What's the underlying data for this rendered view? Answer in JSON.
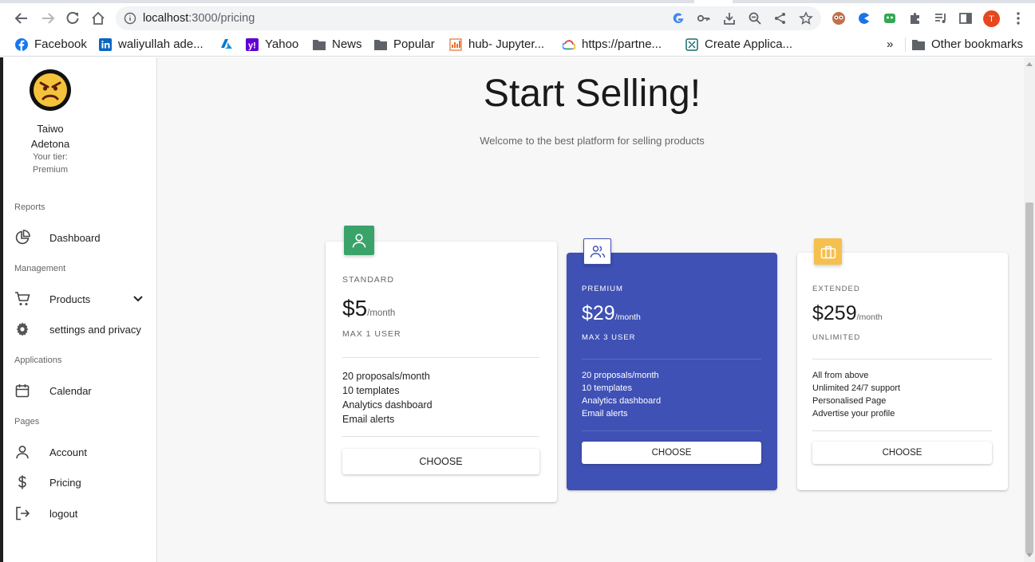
{
  "browser": {
    "url_host": "localhost",
    "url_path": ":3000/pricing",
    "profile_initial": "T",
    "bookmarks": [
      {
        "label": "Facebook",
        "icon": "facebook-icon"
      },
      {
        "label": "waliyullah ade...",
        "icon": "linkedin-icon"
      },
      {
        "label": "",
        "icon": "azure-icon"
      },
      {
        "label": "Yahoo",
        "icon": "yahoo-icon"
      },
      {
        "label": "News",
        "icon": "folder-icon"
      },
      {
        "label": "Popular",
        "icon": "folder-icon"
      },
      {
        "label": "hub- Jupyter...",
        "icon": "jupyter-icon"
      },
      {
        "label": "https://partne...",
        "icon": "google-cloud-icon"
      },
      {
        "label": "Create Applica...",
        "icon": "app-icon"
      }
    ],
    "overflow": "»",
    "other_bookmarks": "Other bookmarks"
  },
  "sidebar": {
    "user_first": "Taiwo",
    "user_last": "Adetona",
    "tier_label": "Your tier:",
    "tier_value": "Premium",
    "sections": {
      "reports": "Reports",
      "management": "Management",
      "applications": "Applications",
      "pages": "Pages"
    },
    "items": {
      "dashboard": "Dashboard",
      "products": "Products",
      "settings": "settings and privacy",
      "calendar": "Calendar",
      "account": "Account",
      "pricing": "Pricing",
      "logout": "logout"
    }
  },
  "hero": {
    "title": "Start Selling!",
    "subtitle": "Welcome to the best platform for selling products"
  },
  "plans": [
    {
      "name": "STANDARD",
      "price": "$5",
      "per": "/month",
      "users": "MAX 1 USER",
      "badge_color": "#3aa36a",
      "features": [
        "20 proposals/month",
        "10 templates",
        "Analytics dashboard",
        "Email alerts"
      ],
      "button": "CHOOSE"
    },
    {
      "name": "PREMIUM",
      "price": "$29",
      "per": "/month",
      "users": "MAX 3 USER",
      "badge_color": "#ffffff",
      "card_color": "#3f51b5",
      "features": [
        "20 proposals/month",
        "10 templates",
        "Analytics dashboard",
        "Email alerts"
      ],
      "button": "CHOOSE"
    },
    {
      "name": "EXTENDED",
      "price": "$259",
      "per": "/month",
      "users": "UNLIMITED",
      "badge_color": "#f6c04e",
      "features": [
        "All from above",
        "Unlimited 24/7 support",
        "Personalised Page",
        "Advertise your profile"
      ],
      "button": "CHOOSE"
    }
  ]
}
